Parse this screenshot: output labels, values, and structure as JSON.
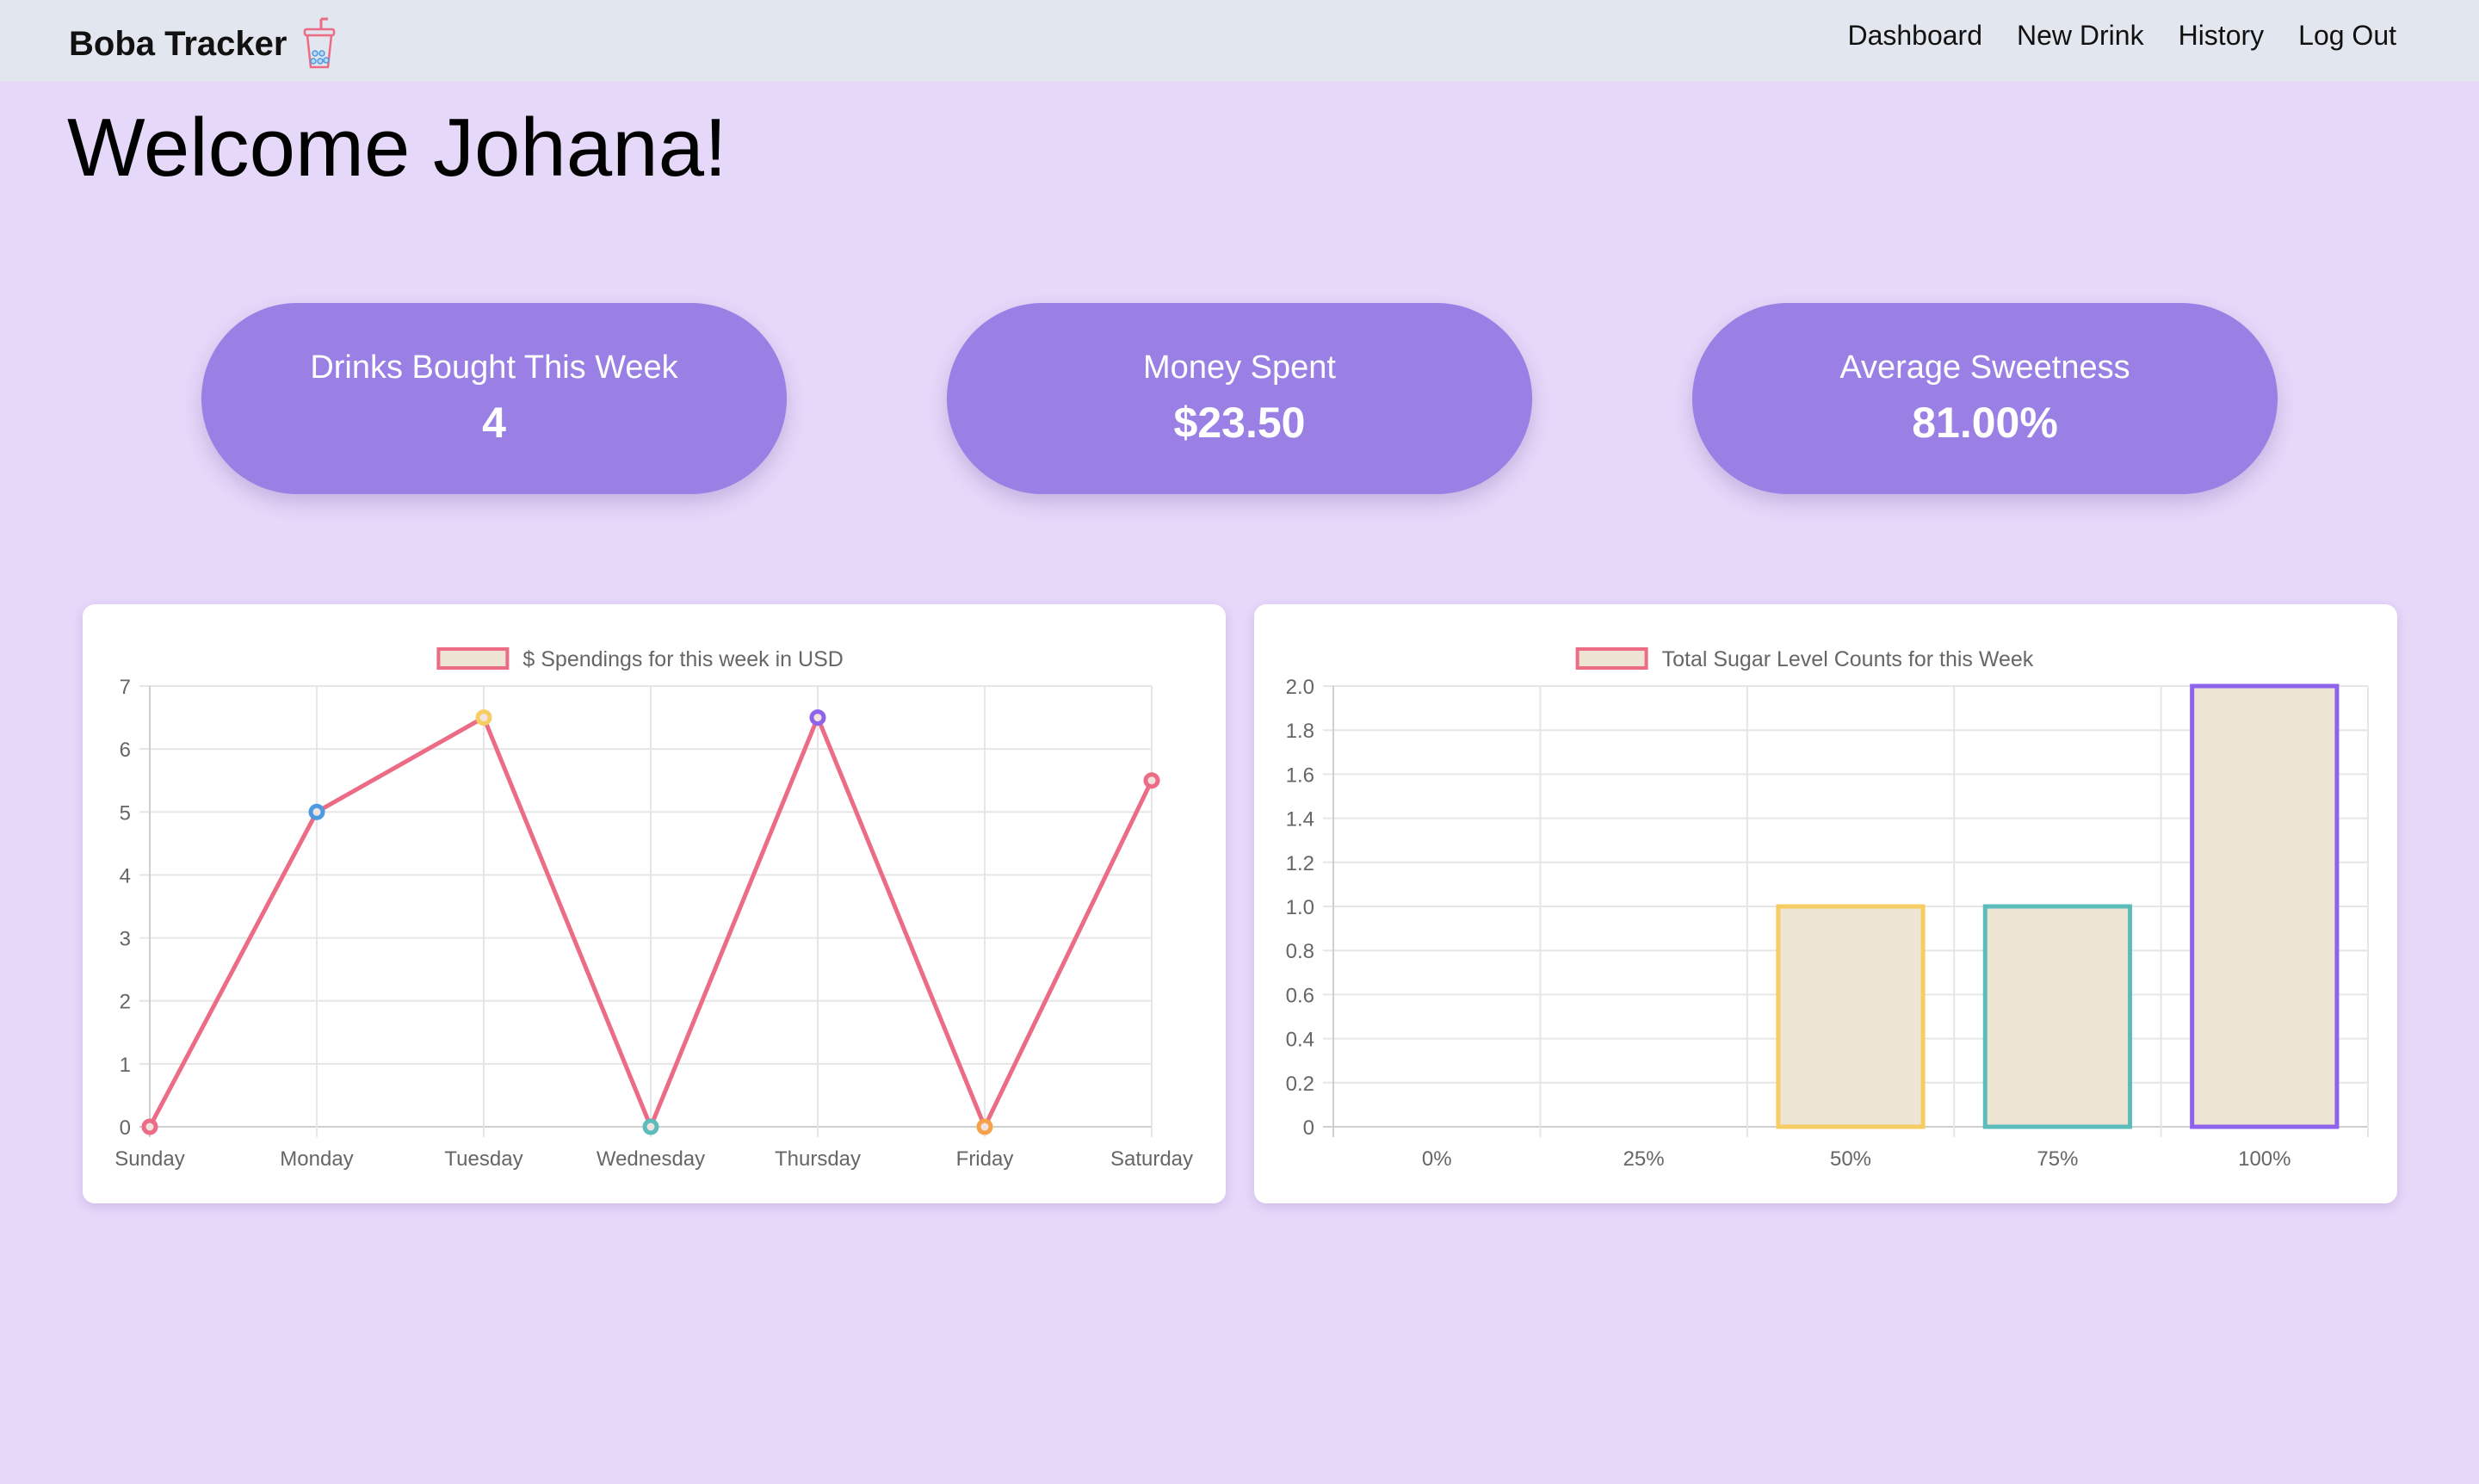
{
  "nav": {
    "brand": "Boba Tracker",
    "links": [
      "Dashboard",
      "New Drink",
      "History",
      "Log Out"
    ]
  },
  "welcome": "Welcome Johana!",
  "stats": [
    {
      "label": "Drinks Bought This Week",
      "value": "4"
    },
    {
      "label": "Money Spent",
      "value": "$23.50"
    },
    {
      "label": "Average Sweetness",
      "value": "81.00%"
    }
  ],
  "colors": {
    "background": "#e6d8f9",
    "navbar": "#e2e6ee",
    "card": "#9a80e4",
    "line": "#ec6b85",
    "bar_fill": "#ede4d4"
  },
  "chart_data": [
    {
      "type": "line",
      "legend": "$ Spendings for this week in USD",
      "categories": [
        "Sunday",
        "Monday",
        "Tuesday",
        "Wednesday",
        "Thursday",
        "Friday",
        "Saturday"
      ],
      "values": [
        0,
        5,
        6.5,
        0,
        6.5,
        0,
        5.5
      ],
      "ylim": [
        0,
        7
      ],
      "yticks": [
        "0",
        "1",
        "2",
        "3",
        "4",
        "5",
        "6",
        "7"
      ],
      "line_color": "#ec6b85",
      "point_colors": [
        "#ec6b85",
        "#4e9ae0",
        "#f6cd62",
        "#5cbcbc",
        "#8d63ec",
        "#f5a14a",
        "#ec6b85"
      ],
      "legend_position": "top",
      "grid": true
    },
    {
      "type": "bar",
      "legend": "Total Sugar Level Counts for this Week",
      "categories": [
        "0%",
        "25%",
        "50%",
        "75%",
        "100%"
      ],
      "values": [
        0,
        0,
        1,
        1,
        2
      ],
      "ylim": [
        0,
        2
      ],
      "yticks": [
        "0",
        "0.2",
        "0.4",
        "0.6",
        "0.8",
        "1.0",
        "1.2",
        "1.4",
        "1.6",
        "1.8",
        "2.0"
      ],
      "bar_fill": "#ede4d4",
      "border_colors": [
        "#ec6b85",
        "#4e9ae0",
        "#f6cd62",
        "#5cbcbc",
        "#8d63ec"
      ],
      "legend_position": "top",
      "grid": true
    }
  ]
}
